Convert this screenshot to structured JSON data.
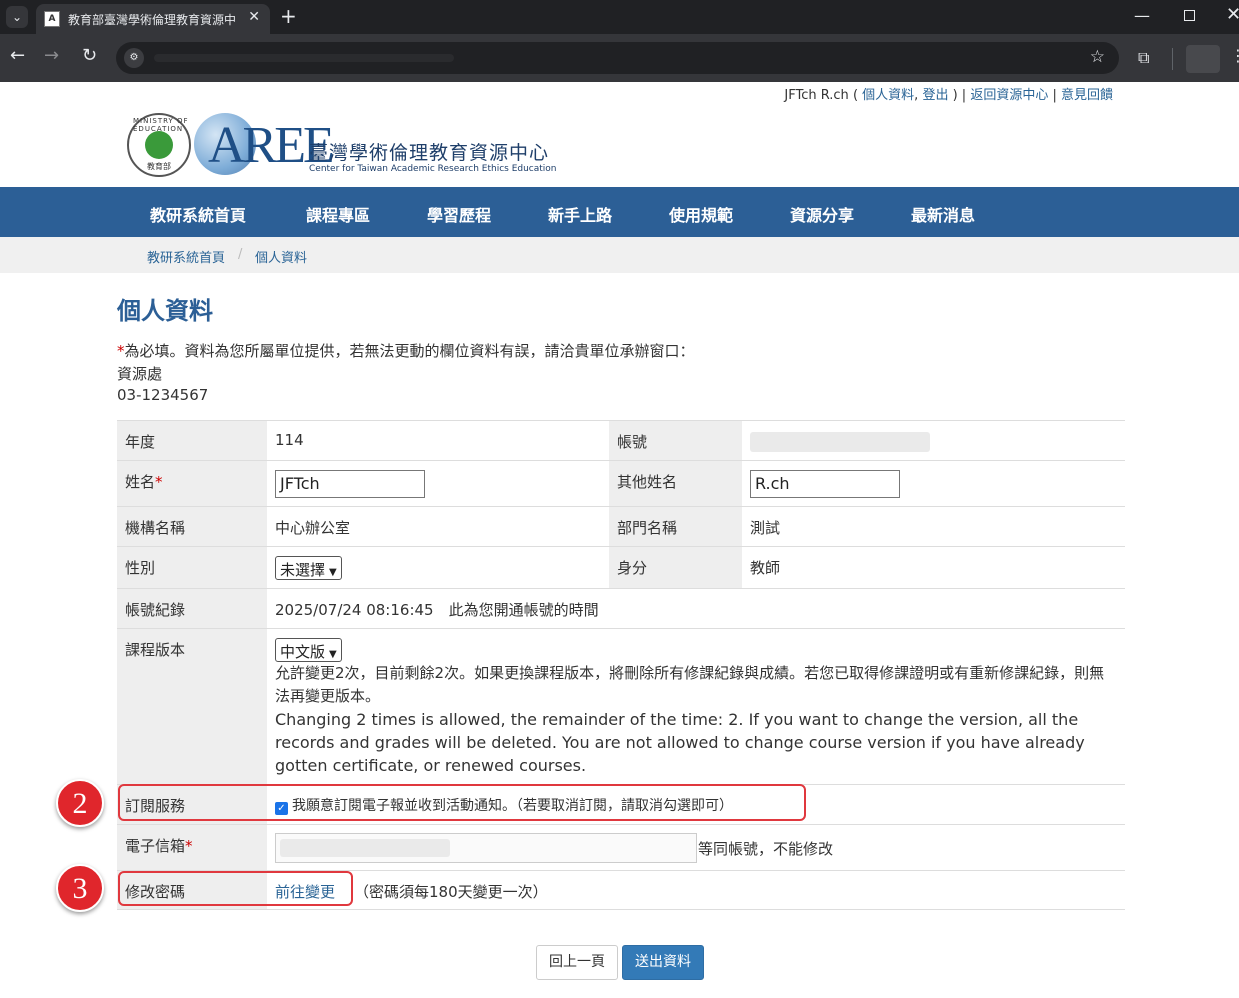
{
  "browser": {
    "tab_title": "教育部臺灣學術倫理教育資源中",
    "favicon_text": "A"
  },
  "toplinks": {
    "user": "JFTch R.ch",
    "open_paren": " ( ",
    "profile": "個人資料",
    "comma": ", ",
    "logout": "登出",
    "close_paren": " ) | ",
    "back_center": "返回資源中心",
    "bar": " | ",
    "feedback": "意見回饋"
  },
  "logo": {
    "aree": "AREE",
    "zh": "臺灣學術倫理教育資源中心",
    "en": "Center for Taiwan Academic Research Ethics Education",
    "seal_ring": "MINISTRY OF EDUCATION",
    "seal_bottom": "教育部"
  },
  "nav": [
    "教研系統首頁",
    "課程專區",
    "學習歷程",
    "新手上路",
    "使用規範",
    "資源分享",
    "最新消息"
  ],
  "breadcrumb": [
    "教研系統首頁",
    "個人資料"
  ],
  "page": {
    "title": "個人資料",
    "note_star": "*",
    "note": "為必填。資料為您所屬單位提供，若無法更動的欄位資料有誤，請洽貴單位承辦窗口：",
    "contact_unit": "資源處",
    "contact_phone": "03-1234567"
  },
  "form": {
    "year_label": "年度",
    "year_value": "114",
    "account_label": "帳號",
    "name_label": "姓名",
    "name_value": "JFTch",
    "other_name_label": "其他姓名",
    "other_name_value": "R.ch",
    "org_label": "機構名稱",
    "org_value": "中心辦公室",
    "dept_label": "部門名稱",
    "dept_value": "測試",
    "gender_label": "性別",
    "gender_value": "未選擇",
    "identity_label": "身分",
    "identity_value": "教師",
    "record_label": "帳號紀錄",
    "record_value": "2025/07/24 08:16:45　此為您開通帳號的時間",
    "version_label": "課程版本",
    "version_value": "中文版",
    "version_note_zh": "允許變更2次，目前剩餘2次。如果更換課程版本，將刪除所有修課紀錄與成績。若您已取得修課證明或有重新修課紀錄，則無法再變更版本。",
    "version_note_en": "Changing 2 times is allowed, the remainder of the time: 2. If you want to change the version, all the records and grades will be deleted. You are not allowed to change course version if you have already gotten certificate, or renewed courses.",
    "subscribe_label": "訂閱服務",
    "subscribe_text": "我願意訂閱電子報並收到活動通知。（若要取消訂閱，請取消勾選即可）",
    "email_label": "電子信箱",
    "email_note": "等同帳號，不能修改",
    "password_label": "修改密碼",
    "password_link": "前往變更",
    "password_note": "（密碼須每180天變更一次）"
  },
  "buttons": {
    "back": "回上一頁",
    "submit": "送出資料"
  },
  "annotations": [
    "2",
    "3"
  ],
  "colors": {
    "nav_bg": "#2c5f96",
    "link": "#2a6496",
    "annotation_red": "#e0262c",
    "submit_bg": "#337ab7"
  }
}
